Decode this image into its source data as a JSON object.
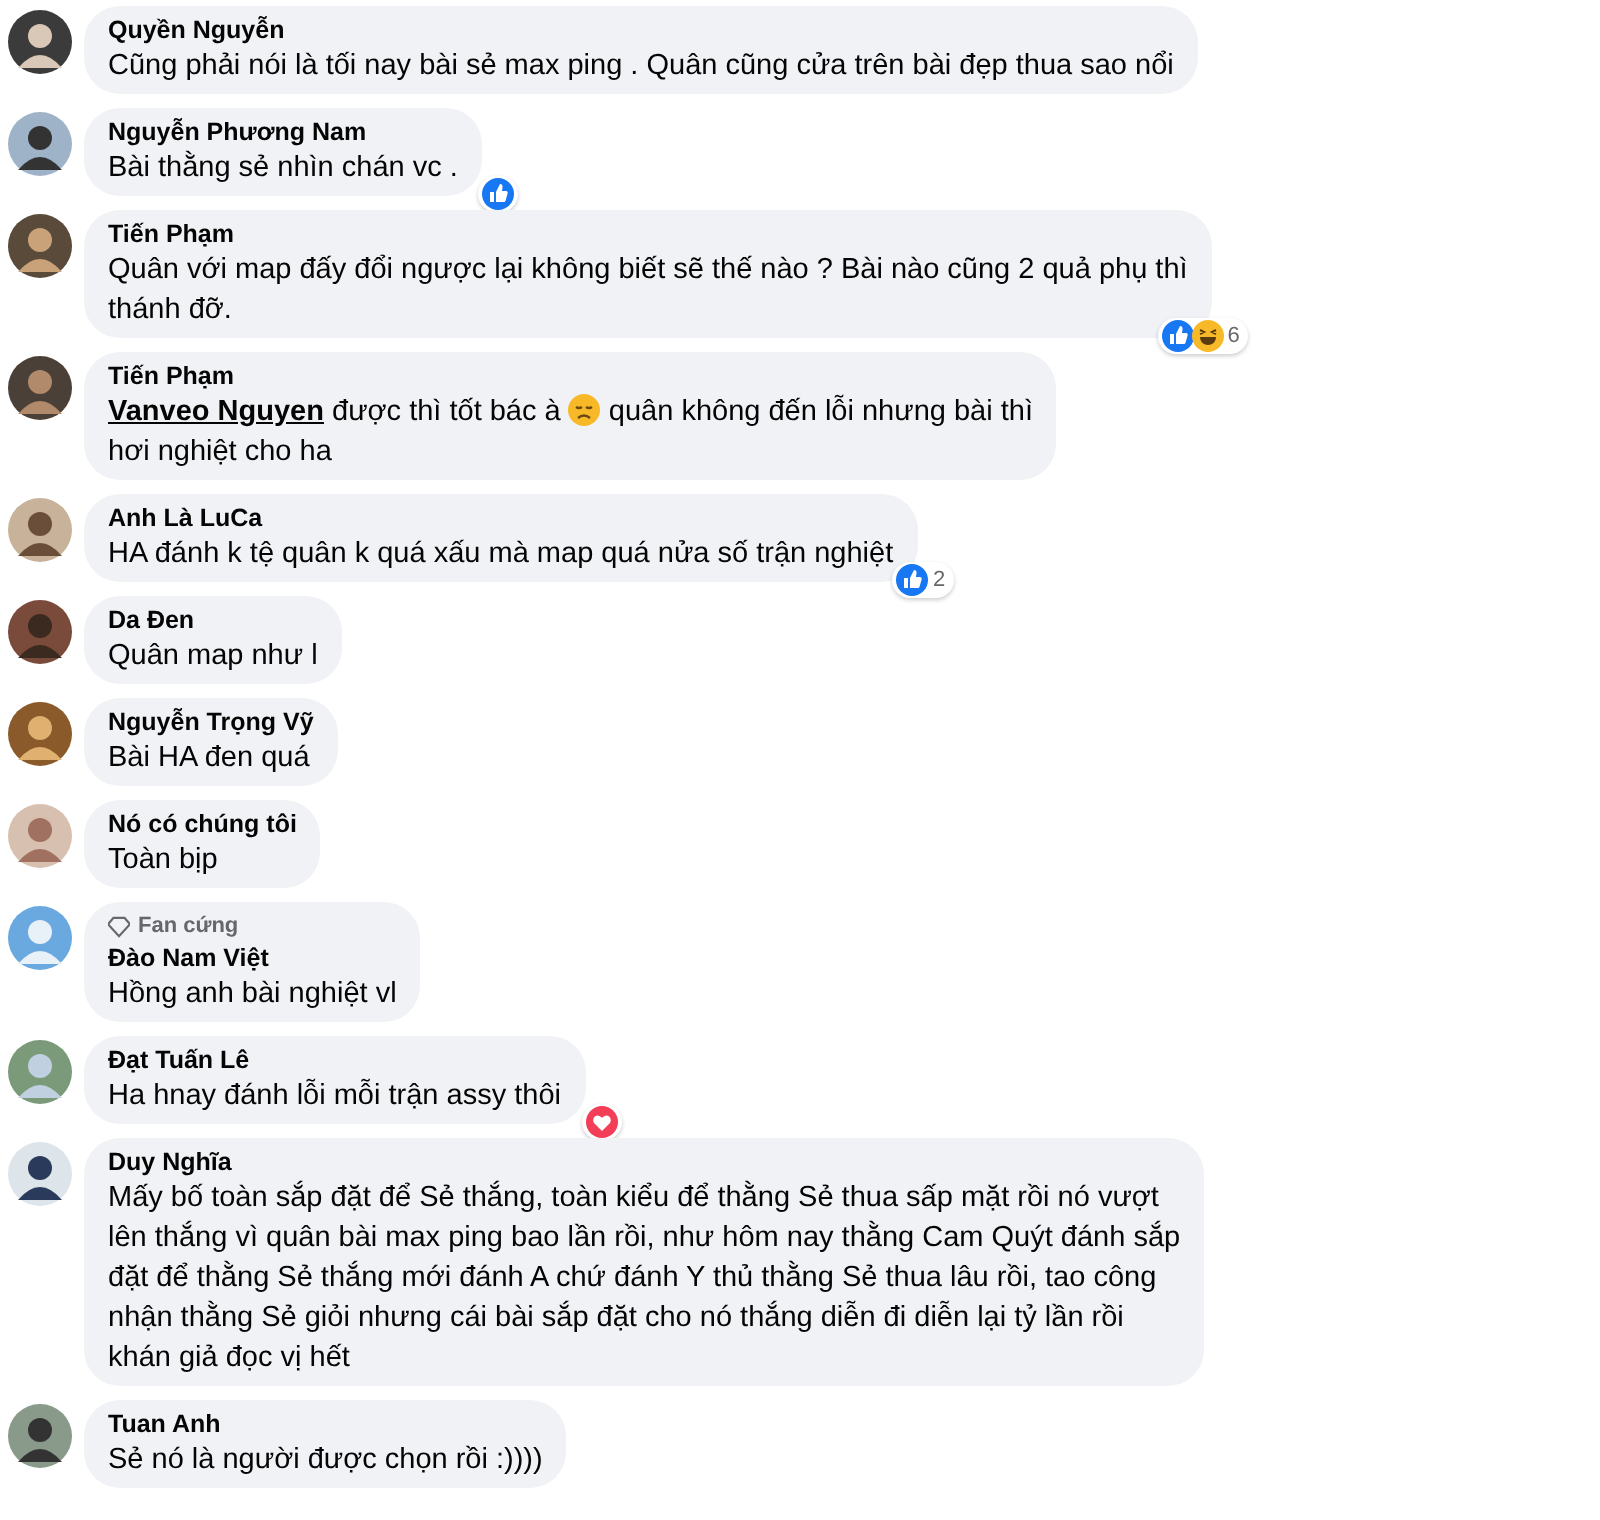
{
  "comments": [
    {
      "author": "Quyền Nguyễn",
      "body": [
        {
          "kind": "text",
          "text": "Cũng phải nói là tối nay bài sẻ max ping . Quân cũng cửa trên bài đẹp thua sao nổi"
        }
      ]
    },
    {
      "author": "Nguyễn Phương Nam",
      "body": [
        {
          "kind": "text",
          "text": "Bài thằng sẻ nhìn chán vc ."
        }
      ],
      "reaction": {
        "icons": [
          {
            "kind": "like"
          }
        ]
      }
    },
    {
      "author": "Tiến Phạm",
      "body": [
        {
          "kind": "text",
          "text": "Quân với map đấy đổi ngược lại không biết sẽ thế nào ? Bài nào cũng 2 quả phụ thì"
        },
        {
          "kind": "break"
        },
        {
          "kind": "text",
          "text": "thánh đỡ."
        }
      ],
      "reaction": {
        "icons": [
          {
            "kind": "like"
          },
          {
            "kind": "haha"
          }
        ],
        "count": "6"
      }
    },
    {
      "author": "Tiến Phạm",
      "body": [
        {
          "kind": "mention",
          "text": "Vanveo Nguyen"
        },
        {
          "kind": "text",
          "text": " được thì tốt bác à "
        },
        {
          "kind": "emoji"
        },
        {
          "kind": "text",
          "text": " quân không đến lỗi nhưng bài thì"
        },
        {
          "kind": "break"
        },
        {
          "kind": "text",
          "text": "hơi nghiệt cho ha"
        }
      ]
    },
    {
      "author": "Anh Là LuCa",
      "body": [
        {
          "kind": "text",
          "text": "HA đánh k tệ quân k quá xấu mà map quá nửa số trận nghiệt"
        }
      ],
      "reaction": {
        "icons": [
          {
            "kind": "like"
          }
        ],
        "count": "2"
      }
    },
    {
      "author": "Da Đen",
      "body": [
        {
          "kind": "text",
          "text": "Quân map như l"
        }
      ]
    },
    {
      "author": "Nguyễn Trọng Vỹ",
      "body": [
        {
          "kind": "text",
          "text": "Bài HA đen quá"
        }
      ]
    },
    {
      "author": "Nó có chúng tôi",
      "body": [
        {
          "kind": "text",
          "text": "Toàn bịp"
        }
      ]
    },
    {
      "badge": "Fan cứng",
      "author": "Đào Nam Việt",
      "body": [
        {
          "kind": "text",
          "text": "Hồng anh bài nghiệt vl"
        }
      ]
    },
    {
      "author": "Đạt Tuấn Lê",
      "body": [
        {
          "kind": "text",
          "text": "Ha hnay đánh lỗi mỗi trận assy thôi"
        }
      ],
      "reaction": {
        "icons": [
          {
            "kind": "love"
          }
        ]
      }
    },
    {
      "author": "Duy Nghĩa",
      "body": [
        {
          "kind": "text",
          "text": "Mấy bố toàn sắp đặt để Sẻ thắng, toàn kiểu để thằng Sẻ thua sấp mặt rồi nó vượt"
        },
        {
          "kind": "break"
        },
        {
          "kind": "text",
          "text": "lên thắng vì quân bài max ping bao lần rồi, như hôm nay thằng Cam Quýt đánh sắp"
        },
        {
          "kind": "break"
        },
        {
          "kind": "text",
          "text": "đặt để thằng Sẻ thắng mới đánh A chứ đánh Y thủ thằng Sẻ thua lâu rồi, tao công"
        },
        {
          "kind": "break"
        },
        {
          "kind": "text",
          "text": "nhận thằng Sẻ giỏi nhưng cái bài sắp đặt cho nó thắng diễn đi diễn lại tỷ lần rồi"
        },
        {
          "kind": "break"
        },
        {
          "kind": "text",
          "text": "khán giả đọc vị hết"
        }
      ]
    },
    {
      "author": "Tuan Anh",
      "body": [
        {
          "kind": "text",
          "text": "Sẻ nó là người được chọn rồi :))))"
        }
      ]
    }
  ]
}
